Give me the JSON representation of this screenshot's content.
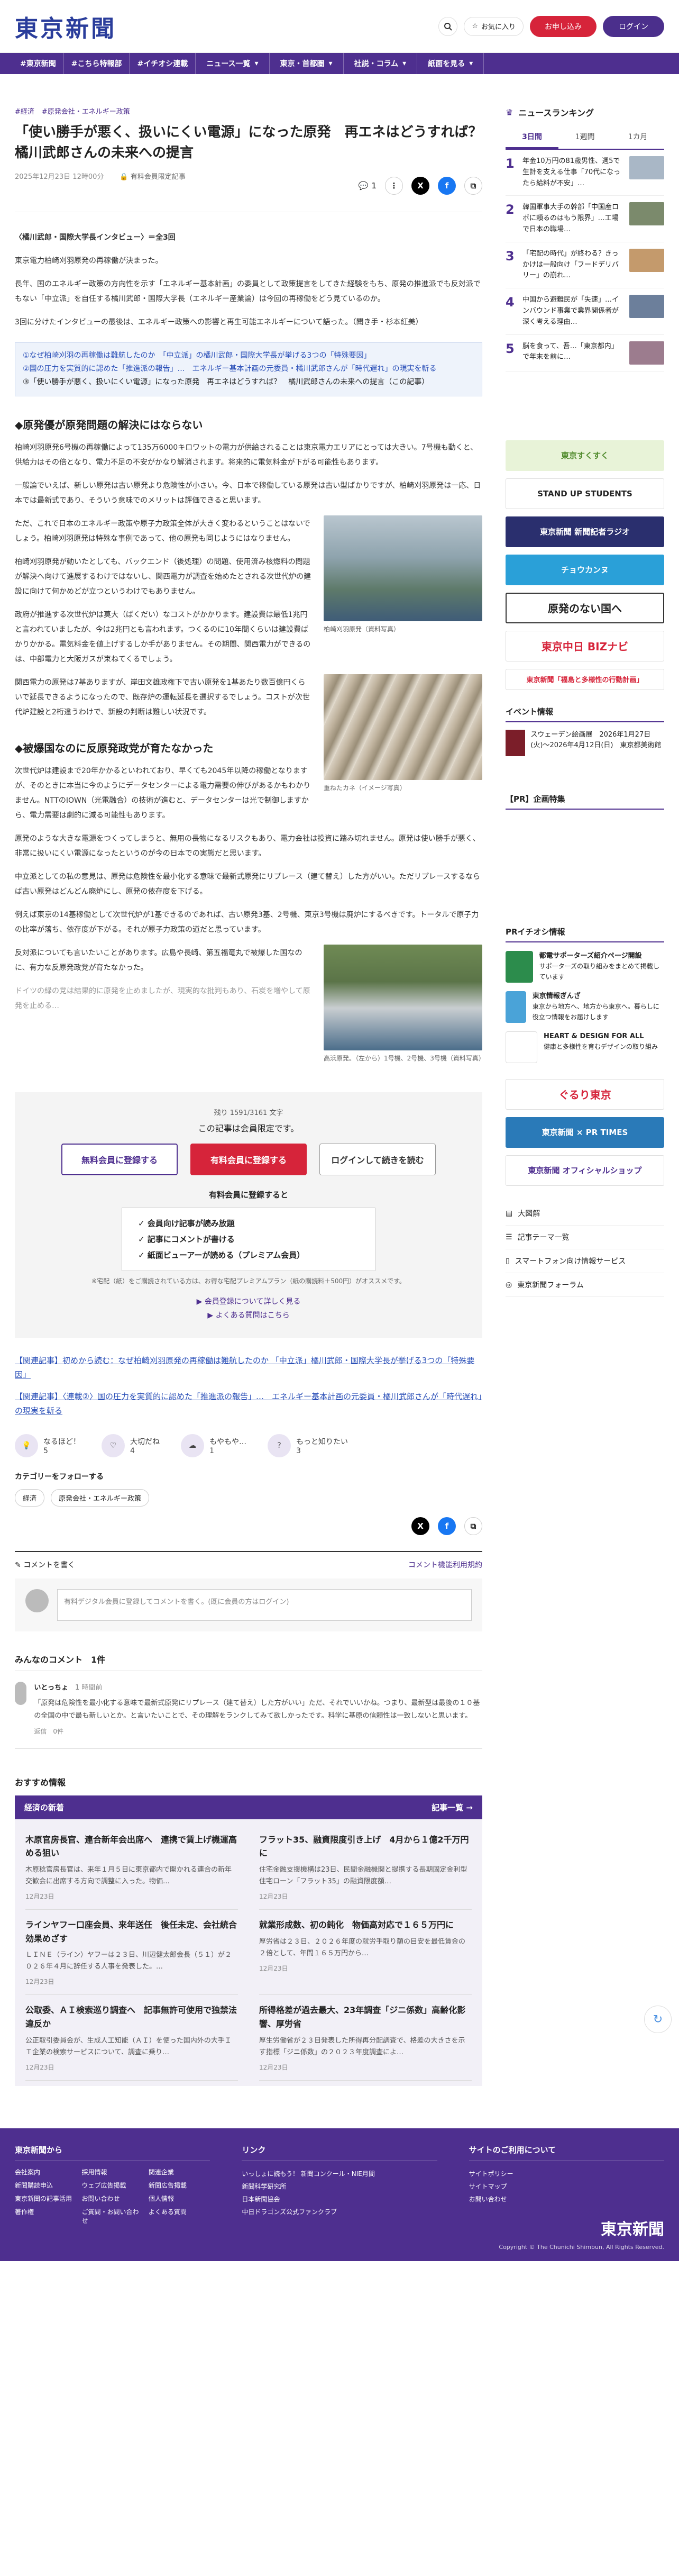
{
  "header": {
    "logo": "東京新聞",
    "favorites_label": "お気に入り",
    "subscribe_label": "お申し込み",
    "login_label": "ログイン"
  },
  "nav": {
    "tags": [
      "#東京新聞",
      "#こちら特報部",
      "#イチオシ連載"
    ],
    "menus": [
      "ニュース一覧",
      "東京・首都圏",
      "社説・コラム",
      "紙面を見る"
    ]
  },
  "breadcrumb": [
    "#経済",
    "#原発会社・エネルギー政策"
  ],
  "article": {
    "title": "「使い勝手が悪く、扱いにくい電源」になった原発　再エネはどうすれば？　橘川武郎さんの未来への提言",
    "date": "2025年12月23日 12時00分",
    "paid_label": "有料会員限定記事",
    "comment_count": "1",
    "lead_heading": "〈橘川武郎・国際大学長インタビュー〉＝全3回",
    "paragraphs": [
      "東京電力柏崎刈羽原発の再稼働が決まった。",
      "長年、国のエネルギー政策の方向性を示す「エネルギー基本計画」の委員として政策提言をしてきた経験をもち、原発の推進派でも反対派でもない「中立派」を自任する橘川武郎・国際大学長（エネルギー産業論）は今回の再稼働をどう見ているのか。",
      "3回に分けたインタビューの最後は、エネルギー政策への影響と再生可能エネルギーについて語った。（聞き手・杉本紅美）"
    ],
    "series": [
      "①なぜ柏崎刈羽の再稼働は難航したのか　「中立派」の橘川武郎・国際大学長が挙げる3つの「特殊要因」",
      "②国の圧力を実質的に認めた「推進派の報告」…　エネルギー基本計画の元委員・橘川武郎さんが「時代遅れ」の現実を斬る",
      "③「使い勝手が悪く、扱いにくい電源」になった原発　再エネはどうすれば？　橘川武郎さんの未来への提言（この記事）"
    ],
    "section1_title": "◆原発優が原発問題の解決にはならない",
    "section1": [
      "柏崎刈羽原発6号機の再稼働によって135万6000キロワットの電力が供給されることは東京電力エリアにとっては大きい。7号機も動くと、供給力はその倍となり、電力不足の不安がかなり解消されます。将来的に電気料金が下がる可能性もあります。",
      "一般論でいえば、新しい原発は古い原発より危険性が小さい。今、日本で稼働している原発は古い型ばかりですが、柏崎刈羽原発は一応、日本では最新式であり、そういう意味でのメリットは評価できると思います。",
      "ただ、これで日本のエネルギー政策や原子力政策全体が大きく変わるということはないでしょう。柏崎刈羽原発は特殊な事例であって、他の原発も同じようにはなりません。",
      "柏崎刈羽原発が動いたとしても、バックエンド（後処理）の問題、使用済み核燃料の問題が解決へ向けて進展するわけではないし、関西電力が調査を始めたとされる次世代炉の建設に向けて何かめどが立つというわけでもありません。",
      "政府が推進する次世代炉は莫大（ばくだい）なコストがかかります。建設費は最低1兆円と言われていましたが、今は2兆円とも言われます。つくるのに10年間くらいは建設費ばかりかかる。電気料金を値上げするしか手がありません。その期間、関西電力ができるのは、中部電力と大阪ガスが束ねてくるでしょう。",
      "関西電力の原発は7基ありますが、岸田文雄政権下で古い原発を1基あたり数百億円くらいで延長できるようになったので、既存炉の運転延長を選択するでしょう。コストが次世代炉建設と2桁違うわけで、新設の判断は難しい状況です。"
    ],
    "section2_title": "◆被爆国なのに反原発政党が育たなかった",
    "section2": [
      "次世代炉は建設まで20年かかるといわれており、早くても2045年以降の稼働となりますが、そのときに本当に今のようにデータセンターによる電力需要の伸びがあるかもわかりません。NTTのIOWN（光電融合）の技術が進むと、データセンターは光で制御しますから、電力需要は劇的に減る可能性もあります。",
      "原発のような大きな電源をつくってしまうと、無用の長物になるリスクもあり、電力会社は投資に踏み切れません。原発は使い勝手が悪く、非常に扱いにくい電源になったというのが今の日本での実態だと思います。",
      "中立派としての私の意見は、原発は危険性を最小化する意味で最新式原発にリプレース（建て替え）した方がいい。ただリプレースするならば古い原発はどんどん廃炉にし、原発の依存度を下げる。",
      "例えば東京の14基稼働として次世代炉が1基できるのであれば、古い原発3基、2号機、東京3号機は廃炉にするべきです。トータルで原子力の比率が落ち、依存度が下がる。それが原子力政策の道だと思っています。",
      "反対派についても言いたいことがあります。広島や長崎、第五福竜丸で被爆した国なのに、有力な反原発政党が育たなかった。",
      "ドイツの緑の党は結果的に原発を止めましたが、現実的な批判もあり、石炭を増やして原発を止める…"
    ],
    "captions": [
      "柏崎刈羽原発（資料写真）",
      "重ねたカネ（イメージ写真）",
      "高浜原発。（左から）1号機、2号機、3号機（資料写真）"
    ]
  },
  "paywall": {
    "count": "残り 1591/3161 文字",
    "message": "この記事は会員限定です。",
    "btn_free": "無料会員に登録する",
    "btn_paid": "有料会員に登録する",
    "btn_login": "ログインして続きを読む",
    "benefits_title": "有料会員に登録すると",
    "benefits": [
      "✓ 会員向け記事が読み放題",
      "✓ 記事にコメントが書ける",
      "✓ 紙面ビューアーが読める（プレミアム会員）"
    ],
    "note": "※宅配（紙）をご購読されている方は、お得な宅配プレミアムプラン（紙の購読料＋500円）がオススメです。",
    "links": [
      "▶ 会員登録について詳しく見る",
      "▶ よくある質問はこちら"
    ]
  },
  "related": [
    "【関連記事】初めから読む：なぜ柏崎刈羽原発の再稼働は難航したのか 「中立派」橘川武郎・国際大学長が挙げる3つの「特殊要因」",
    "【関連記事】〈連載②〉国の圧力を実質的に認めた「推進派の報告」…　エネルギー基本計画の元委員・橘川武郎さんが「時代遅れ」の現実を斬る"
  ],
  "reactions": [
    {
      "label": "なるほど！",
      "count": "5"
    },
    {
      "label": "大切だね",
      "count": "4"
    },
    {
      "label": "もやもや…",
      "count": "1"
    },
    {
      "label": "もっと知りたい",
      "count": "3"
    }
  ],
  "categories": {
    "title": "カテゴリーをフォローする",
    "items": [
      "経済",
      "原発会社・エネルギー政策"
    ]
  },
  "comments": {
    "post_title": "コメントを書く",
    "post_link": "コメント機能利用規約",
    "input_placeholder": "有料デジタル会員に登録してコメントを書く。(既に会員の方はログイン)",
    "list_title": "みんなのコメント　1件",
    "items": [
      {
        "name": "いとっちょ",
        "meta": "1 時間前",
        "text": "「原発は危険性を最小化する意味で最新式原発にリプレース（建て替え）した方がいい」ただ、それでいいかね。つまり、最新型は最後の１０基の全国の中で最も新しいとか。と言いたいことで、その理解をランクしてみて欲しかったです。科学に基原の信頼性は一致しないと思います。",
        "likes": "返信　0件"
      }
    ]
  },
  "recommend": {
    "title": "おすすめ情報",
    "section_title": "経済の新着",
    "more": "記事一覧 →",
    "items": [
      {
        "title": "木原官房長官、連合新年会出席へ　連携で賃上げ機運高める狙い",
        "body": "木原稔官房長官は、来年１月５日に東京都内で開かれる連合の新年交歓会に出席する方向で調整に入った。物価…",
        "date": "12月23日"
      },
      {
        "title": "フラット35、融資限度引き上げ　4月から１億2千万円に",
        "body": "住宅金融支援機構は23日、民間金融機関と提携する長期固定金利型住宅ローン「フラット35」の融資限度額…",
        "date": "12月23日"
      },
      {
        "title": "ラインヤフー口座会員、来年送任　後任未定、会社統合効果めざす",
        "body": "ＬＩＮＥ（ライン）ヤフーは２３日、川辺健太郎会長（５１）が２０２６年４月に辞任する人事を発表した。…",
        "date": "12月23日"
      },
      {
        "title": "就業形成数、初の鈍化　物価高対応で１６５万円に",
        "body": "厚労省は２３日、２０２６年度の就労手取り額の目安を最低賃金の２倍として、年間１６５万円から…",
        "date": "12月23日"
      },
      {
        "title": "公取委、ＡＩ検索巡り調査へ　記事無許可使用で独禁法違反か",
        "body": "公正取引委員会が、生成人工知能（ＡＩ）を使った国内外の大手ＩＴ企業の検索サービスについて、調査に乗り…",
        "date": "12月23日"
      },
      {
        "title": "所得格差が過去最大、23年調査「ジニ係数」高齢化影響、厚労省",
        "body": "厚生労働省が２３日発表した所得再分配調査で、格差の大きさを示す指標「ジニ係数」の２０２３年度調査によ…",
        "date": "12月23日"
      }
    ]
  },
  "sidebar": {
    "ranking_title": "ニュースランキング",
    "tabs": [
      "3日間",
      "1週間",
      "1カ月"
    ],
    "ranking": [
      "年金10万円の81歳男性、週5で生計を支える仕事「70代になったら給料が不安」…",
      "韓国軍事大手の幹部「中国産ロボに頼るのはもう限界」…工場で日本の職場…",
      "「宅配の時代」が終わる？きっかけは一般向け「フードデリバリー」の崩れ…",
      "中国から避難民が「失速」…インバウンド事業で業界関係者が深く考える理由…",
      "脳を食って、吾…「東京都内」で年末を前に…"
    ],
    "banners": [
      "東京すくすく",
      "STAND UP STUDENTS",
      "東京新聞 新聞記者ラジオ",
      "チョウカンヌ",
      "原発のない国へ",
      "東京中日 BIZナビ",
      "東京新聞「福島と多様性の行動計画」"
    ],
    "event_title": "イベント情報",
    "event": "スウェーデン絵画展　2026年1月27日(火)〜2026年4月12日(日)　東京都美術館",
    "pr_title": "【PR】企画特集",
    "pr_title2": "PRイチオシ情報",
    "pr_items": [
      {
        "title": "都電サポーターズ紹介ページ開設",
        "text": "サポーターズの取り組みをまとめて掲載しています"
      },
      {
        "title": "東京情報ぎんざ",
        "text": "東京から地方へ、地方から東京へ。暮らしに役立つ情報をお届けします"
      },
      {
        "title": "HEART & DESIGN FOR ALL",
        "text": "健康と多様性を育むデザインの取り組み"
      }
    ],
    "banners2": [
      "ぐるり東京",
      "東京新聞 × PR TIMES",
      "東京新聞 オフィシャルショップ"
    ],
    "links": [
      "大図解",
      "記事テーマ一覧",
      "スマートフォン向け情報サービス",
      "東京新聞フォーラム"
    ]
  },
  "footer": {
    "col1_title": "東京新聞から",
    "col1": [
      "会社案内",
      "採用情報",
      "関連企業",
      "新聞購読申込",
      "ウェブ広告掲載",
      "新聞広告掲載",
      "東京新聞の記事活用",
      "お問い合わせ",
      "個人情報",
      "著作権",
      "ご質問・お問い合わせ",
      "よくある質問"
    ],
    "col2_title": "リンク",
    "col2": [
      "いっしょに読もう！ 新聞コンクール・NIE月間",
      "新聞科学研究所",
      "日本新聞協会",
      "中日ドラゴンズ公式ファンクラブ"
    ],
    "col3_title": "サイトのご利用について",
    "col3": [
      "サイトポリシー",
      "サイトマップ",
      "お問い合わせ"
    ],
    "logo": "東京新聞",
    "copyright": "Copyright © The Chunichi Shimbun, All Rights Reserved."
  }
}
